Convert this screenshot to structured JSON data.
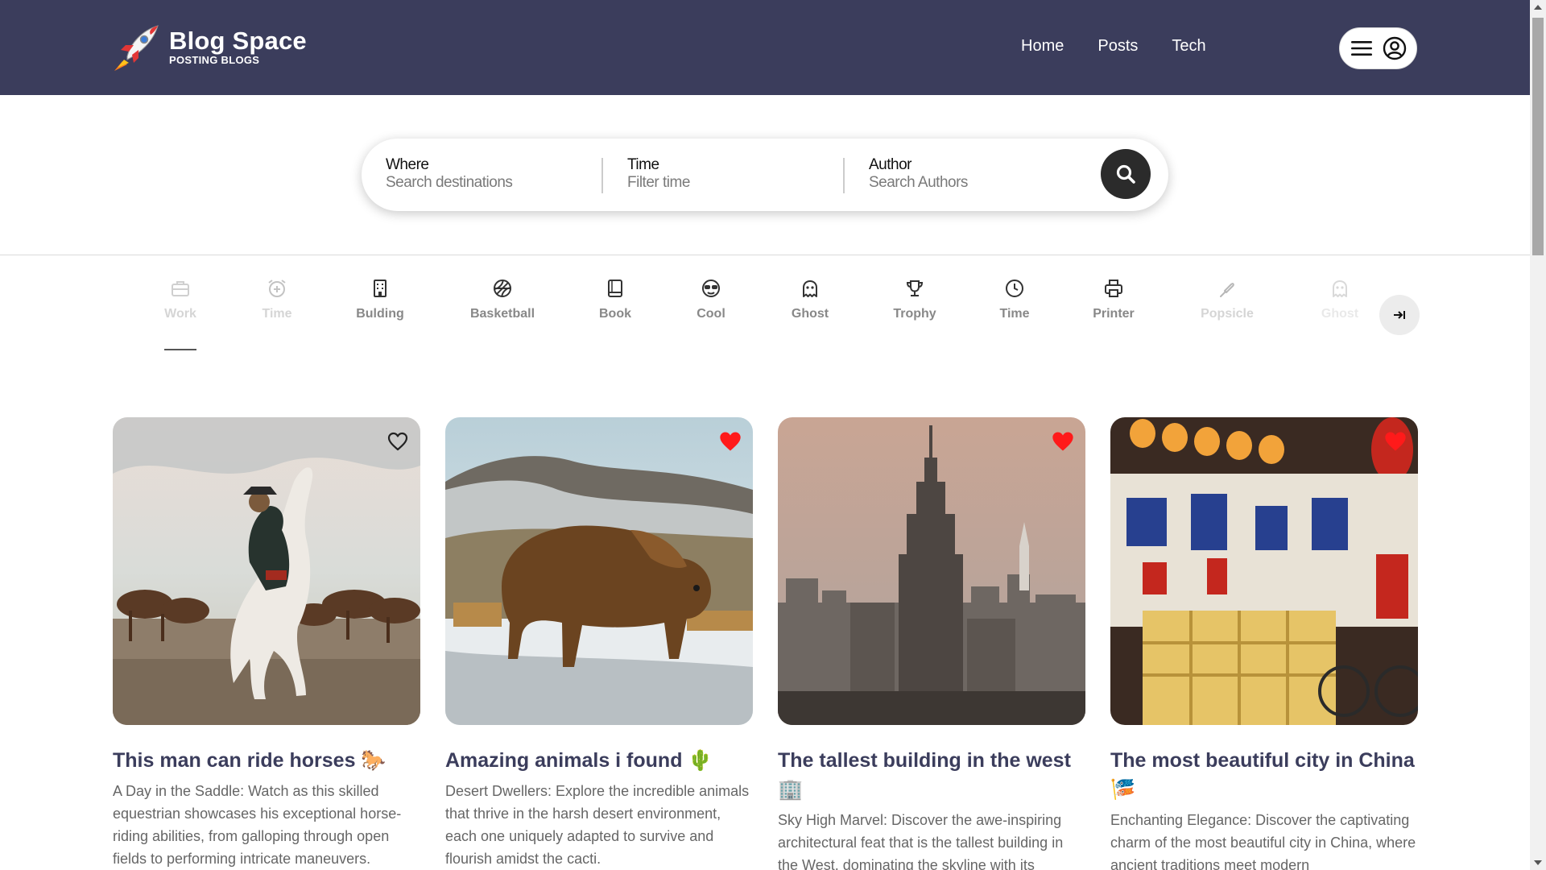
{
  "brand": {
    "title": "Blog Space",
    "subtitle": "POSTING BLOGS"
  },
  "nav": [
    {
      "label": "Home"
    },
    {
      "label": "Posts"
    },
    {
      "label": "Tech"
    }
  ],
  "search": {
    "fields": [
      {
        "label": "Where",
        "placeholder": "Search destinations"
      },
      {
        "label": "Time",
        "placeholder": "Filter time"
      },
      {
        "label": "Author",
        "placeholder": "Search Authors"
      }
    ]
  },
  "categories": [
    {
      "label": "Work",
      "icon": "briefcase-icon"
    },
    {
      "label": "Time",
      "icon": "alarm-clock-icon"
    },
    {
      "label": "Bulding",
      "icon": "building-icon"
    },
    {
      "label": "Basketball",
      "icon": "basketball-icon"
    },
    {
      "label": "Book",
      "icon": "book-icon"
    },
    {
      "label": "Cool",
      "icon": "sunglasses-face-icon"
    },
    {
      "label": "Ghost",
      "icon": "ghost-icon"
    },
    {
      "label": "Trophy",
      "icon": "trophy-icon"
    },
    {
      "label": "Time",
      "icon": "clock-icon"
    },
    {
      "label": "Printer",
      "icon": "printer-icon"
    },
    {
      "label": "Popsicle",
      "icon": "popsicle-icon"
    },
    {
      "label": "Ghost",
      "icon": "ghost-icon"
    }
  ],
  "posts": [
    {
      "title": "This man can ride horses 🐎",
      "description": "A Day in the Saddle: Watch as this skilled equestrian showcases his exceptional horse-riding abilities, from galloping through open fields to performing intricate maneuvers.",
      "favorited": false
    },
    {
      "title": "Amazing animals i found 🌵",
      "description": "Desert Dwellers: Explore the incredible animals that thrive in the harsh desert environment, each one uniquely adapted to survive and flourish amidst the cacti.",
      "favorited": true
    },
    {
      "title": "The tallest building in the west 🏢",
      "description": "Sky High Marvel: Discover the awe-inspiring architectural feat that is the tallest building in the West, dominating the skyline with its",
      "favorited": true
    },
    {
      "title": "The most beautiful city in China 🎏",
      "description": "Enchanting Elegance: Discover the captivating charm of the most beautiful city in China, where ancient traditions meet modern",
      "favorited": true
    }
  ],
  "colors": {
    "header": "#3b3d5c",
    "heart": "#ff1a1a",
    "titleText": "#3b3d5c"
  }
}
